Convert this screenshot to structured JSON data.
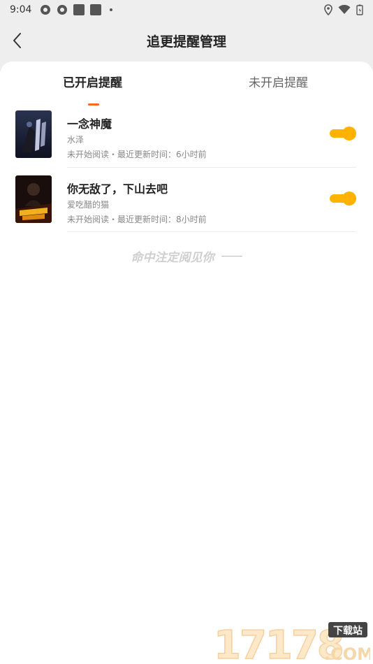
{
  "status_bar": {
    "time": "9:04"
  },
  "header": {
    "title": "追更提醒管理"
  },
  "tabs": [
    {
      "label": "已开启提醒",
      "active": true
    },
    {
      "label": "未开启提醒",
      "active": false
    }
  ],
  "books": [
    {
      "title": "一念神魔",
      "author": "水泽",
      "status": "未开始阅读・最近更新时间：6小时前",
      "reminder_on": true
    },
    {
      "title": "你无敌了，下山去吧",
      "author": "爱吃醋的猫",
      "status": "未开始阅读・最近更新时间：8小时前",
      "reminder_on": true
    }
  ],
  "footer_note": "命中注定阅见你",
  "watermark": {
    "number": "17178",
    "tag": "下载站",
    "domain": ".COM"
  },
  "colors": {
    "accent": "#ff6a1a",
    "toggle": "#ffb300",
    "card_bg": "#ffffff",
    "page_bg": "#eeeeee"
  }
}
